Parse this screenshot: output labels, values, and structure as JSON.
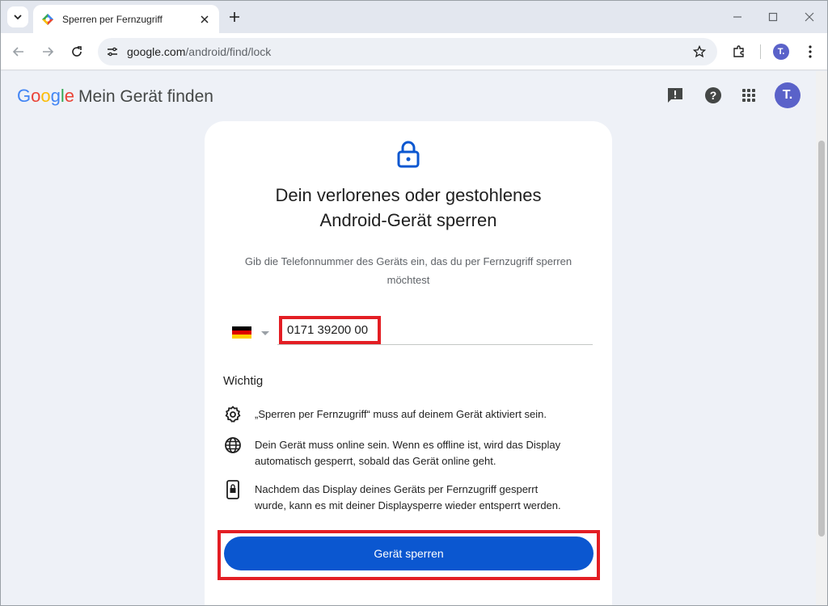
{
  "browser": {
    "tab_title": "Sperren per Fernzugriff",
    "url_host": "google.com",
    "url_path": "/android/find/lock",
    "profile_initial": "T."
  },
  "header": {
    "logo": [
      "G",
      "o",
      "o",
      "g",
      "l",
      "e"
    ],
    "product_name": "Mein Gerät finden",
    "avatar_initial": "T.",
    "icons": [
      "feedback-icon",
      "help-icon",
      "apps-grid-icon"
    ]
  },
  "card": {
    "title_line1": "Dein verlorenes oder gestohlenes",
    "title_line2": "Android-Gerät sperren",
    "subtitle_line1": "Gib die Telefonnummer des Geräts ein, das du per Fernzugriff sperren",
    "subtitle_line2": "möchtest",
    "country_flag": "DE",
    "phone_value": "0171 39200 00",
    "important_heading": "Wichtig",
    "info_items": [
      {
        "icon": "settings-icon",
        "line1": "„Sperren per Fernzugriff“ muss auf deinem Gerät aktiviert sein.",
        "line2": ""
      },
      {
        "icon": "globe-icon",
        "line1": "Dein Gerät muss online sein. Wenn es offline ist, wird das Display",
        "line2": "automatisch gesperrt, sobald das Gerät online geht."
      },
      {
        "icon": "phone-lock-icon",
        "line1": "Nachdem das Display deines Geräts per Fernzugriff gesperrt",
        "line2": "wurde, kann es mit deiner Displaysperre wieder entsperrt werden."
      }
    ],
    "lock_button": "Gerät sperren"
  },
  "colors": {
    "primary_button": "#0b57d0",
    "highlight": "#e31e24",
    "avatar": "#5a62c9"
  }
}
